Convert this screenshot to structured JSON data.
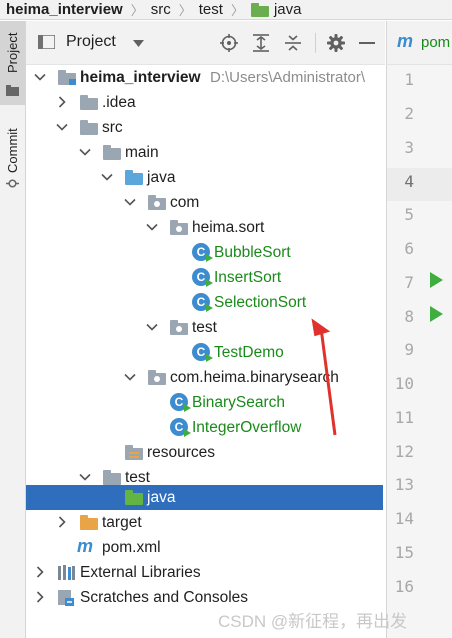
{
  "breadcrumb": {
    "project": "heima_interview",
    "segments": [
      "src",
      "test",
      "java"
    ]
  },
  "toolstrip": {
    "project_tab": "Project",
    "commit_tab": "Commit"
  },
  "panel": {
    "title": "Project",
    "icons": [
      "chevron-down-icon",
      "locate-icon",
      "expand-all-icon",
      "collapse-all-icon",
      "gear-icon",
      "minimize-icon"
    ]
  },
  "tree": [
    {
      "name": "heima_interview",
      "path": "D:\\Users\\Administrator\\",
      "kind": "module",
      "expanded": true
    },
    {
      "name": ".idea",
      "kind": "folder",
      "expanded": false
    },
    {
      "name": "src",
      "kind": "folder",
      "expanded": true
    },
    {
      "name": "main",
      "kind": "folder",
      "expanded": true
    },
    {
      "name": "java",
      "kind": "source-root",
      "expanded": true
    },
    {
      "name": "com",
      "kind": "package",
      "expanded": true
    },
    {
      "name": "heima.sort",
      "kind": "package",
      "expanded": true
    },
    {
      "name": "BubbleSort",
      "kind": "class"
    },
    {
      "name": "InsertSort",
      "kind": "class"
    },
    {
      "name": "SelectionSort",
      "kind": "class"
    },
    {
      "name": "test",
      "kind": "package",
      "expanded": true
    },
    {
      "name": "TestDemo",
      "kind": "class"
    },
    {
      "name": "com.heima.binarysearch",
      "kind": "package",
      "expanded": true
    },
    {
      "name": "BinarySearch",
      "kind": "class"
    },
    {
      "name": "IntegerOverflow",
      "kind": "class"
    },
    {
      "name": "resources",
      "kind": "resources-root"
    },
    {
      "name": "test",
      "kind": "folder",
      "expanded": true
    },
    {
      "name": "java",
      "kind": "test-root",
      "selected": true
    },
    {
      "name": "target",
      "kind": "excluded-folder",
      "expanded": false
    },
    {
      "name": "pom.xml",
      "kind": "maven-file"
    },
    {
      "name": "External Libraries",
      "kind": "libraries",
      "expanded": false
    },
    {
      "name": "Scratches and Consoles",
      "kind": "scratches",
      "expanded": false
    }
  ],
  "class_glyph": "C",
  "maven_glyph": "m",
  "editor": {
    "tab_label": "pom",
    "current_line": 4,
    "run_lines": [
      7,
      8
    ],
    "line_numbers": [
      "1",
      "2",
      "3",
      "4",
      "5",
      "6",
      "7",
      "8",
      "9",
      "10",
      "11",
      "12",
      "13",
      "14",
      "15",
      "16"
    ]
  },
  "watermark": "CSDN @新征程，再出发",
  "colors": {
    "selection": "#2f6ebc",
    "class_name": "#1a8a1a",
    "annotation_arrow": "#e0312d"
  }
}
